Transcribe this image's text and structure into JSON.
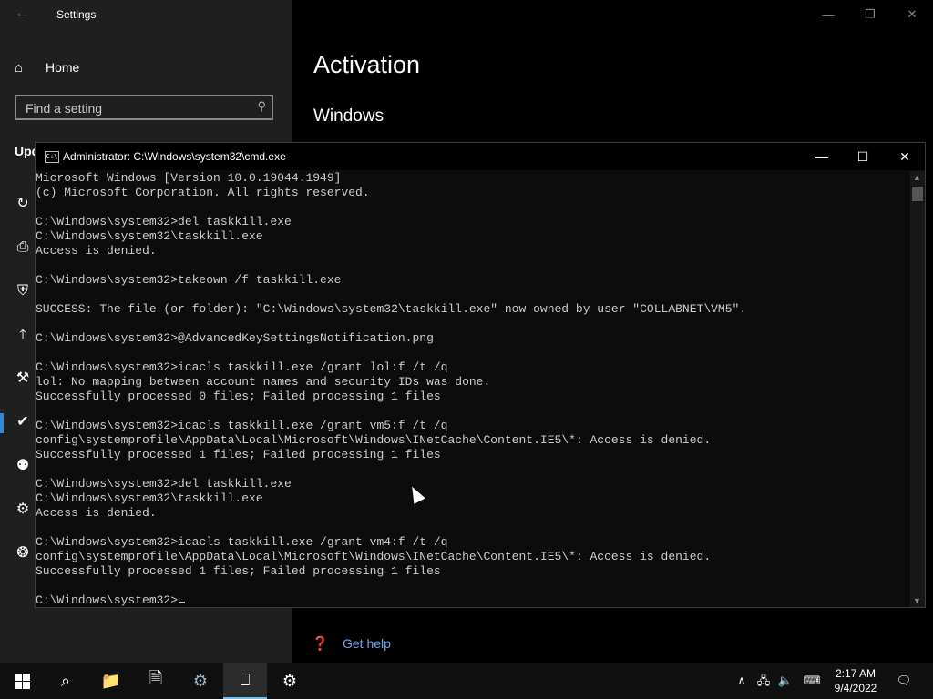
{
  "settings": {
    "title": "Settings",
    "back_icon": "←",
    "home_label": "Home",
    "home_icon": "⌂",
    "search_placeholder": "Find a setting",
    "search_icon": "⚲",
    "category_label": "Upd",
    "page_title": "Activation",
    "section_title": "Windows",
    "help_label": "Get help",
    "help_icon": "❓",
    "window_controls": {
      "minimize": "—",
      "maximize": "❒",
      "close": "✕"
    },
    "sidebar_icons": [
      "↻",
      "⎙",
      "⛨",
      "⤒",
      "⚒",
      "✔",
      "⚉",
      "⚙",
      "❂"
    ]
  },
  "cmd": {
    "title": "Administrator: C:\\Windows\\system32\\cmd.exe",
    "icon_text": "C:\\",
    "window_controls": {
      "minimize": "—",
      "maximize": "☐",
      "close": "✕"
    },
    "lines": [
      "Microsoft Windows [Version 10.0.19044.1949]",
      "(c) Microsoft Corporation. All rights reserved.",
      "",
      "C:\\Windows\\system32>del taskkill.exe",
      "C:\\Windows\\system32\\taskkill.exe",
      "Access is denied.",
      "",
      "C:\\Windows\\system32>takeown /f taskkill.exe",
      "",
      "SUCCESS: The file (or folder): \"C:\\Windows\\system32\\taskkill.exe\" now owned by user \"COLLABNET\\VM5\".",
      "",
      "C:\\Windows\\system32>@AdvancedKeySettingsNotification.png",
      "",
      "C:\\Windows\\system32>icacls taskkill.exe /grant lol:f /t /q",
      "lol: No mapping between account names and security IDs was done.",
      "Successfully processed 0 files; Failed processing 1 files",
      "",
      "C:\\Windows\\system32>icacls taskkill.exe /grant vm5:f /t /q",
      "config\\systemprofile\\AppData\\Local\\Microsoft\\Windows\\INetCache\\Content.IE5\\*: Access is denied.",
      "Successfully processed 1 files; Failed processing 1 files",
      "",
      "C:\\Windows\\system32>del taskkill.exe",
      "C:\\Windows\\system32\\taskkill.exe",
      "Access is denied.",
      "",
      "C:\\Windows\\system32>icacls taskkill.exe /grant vm4:f /t /q",
      "config\\systemprofile\\AppData\\Local\\Microsoft\\Windows\\INetCache\\Content.IE5\\*: Access is denied.",
      "Successfully processed 1 files; Failed processing 1 files",
      "",
      "C:\\Windows\\system32>"
    ]
  },
  "taskbar": {
    "search_icon": "⌕",
    "apps": [
      {
        "name": "file-explorer",
        "icon": "📁",
        "active": false
      },
      {
        "name": "notepad",
        "icon": "🗎",
        "active": false
      },
      {
        "name": "control-panel",
        "icon": "⚙",
        "active": false
      },
      {
        "name": "command-prompt",
        "icon": "⎕",
        "active": true
      },
      {
        "name": "settings",
        "icon": "⚙",
        "active": false
      }
    ],
    "tray": {
      "chevron": "∧",
      "network": "🖧",
      "volume": "🔈",
      "keyboard": "⌨",
      "notification": "🗨"
    },
    "time": "2:17 AM",
    "date": "9/4/2022"
  },
  "colors": {
    "accent": "#3a86d6",
    "link": "#6aa8f0",
    "console_text": "#cccccc",
    "console_bg": "#0c0c0c"
  }
}
